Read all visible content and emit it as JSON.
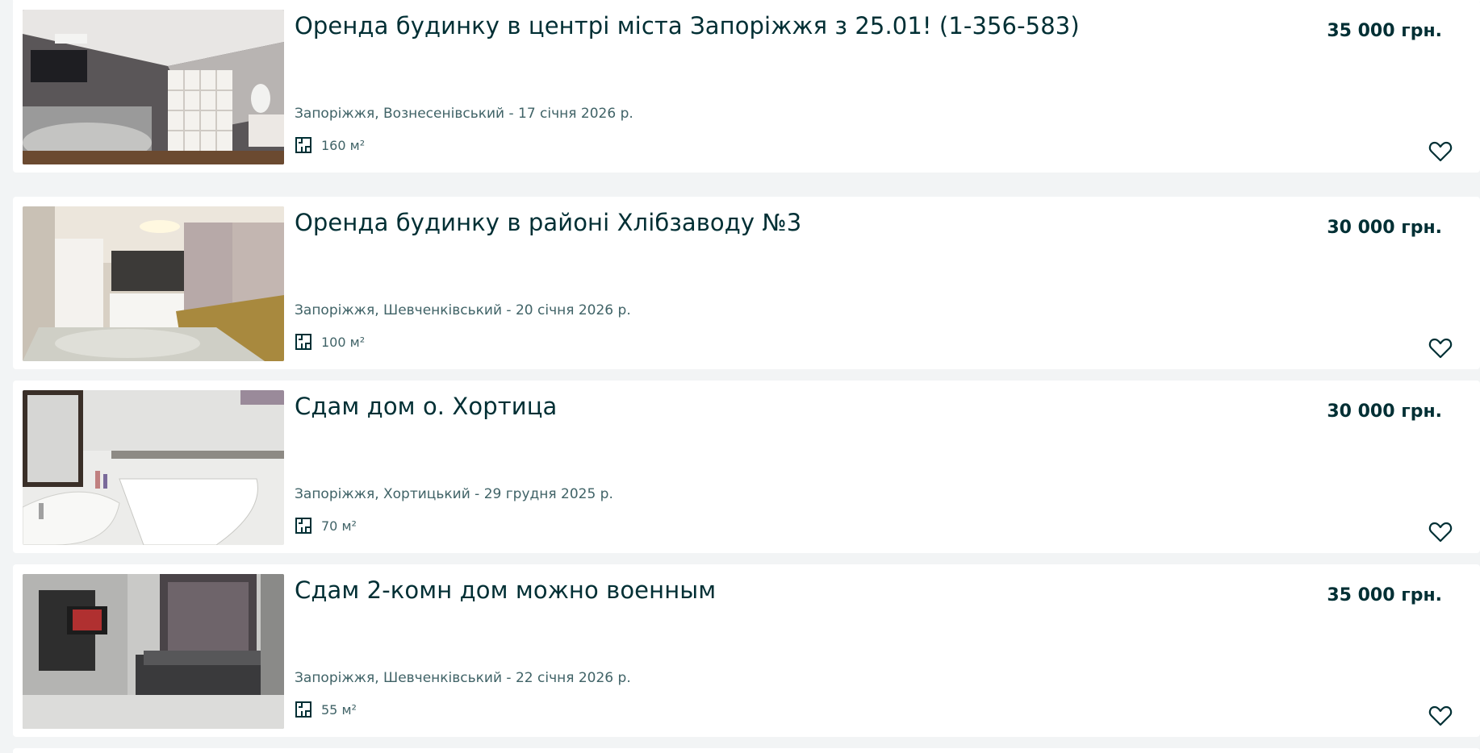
{
  "listings": [
    {
      "title": "Оренда будинку в районі Хлібзаводу №3",
      "price": "30 000 грн.",
      "location_date": "Запоріжжя, Шевченківський - 20 січня 2026 р.",
      "area": "100 м²",
      "photo": "living room with beige sofa and TV wall"
    },
    {
      "title": "Сдам дом о. Хортица",
      "price": "30 000 грн.",
      "location_date": "Запоріжжя, Хортицький - 29 грудня 2025 р.",
      "area": "70 м²",
      "photo": "bathroom with corner bathtub and sink"
    },
    {
      "title": "Сдам 2-комн дом можно военным",
      "price": "35 000 грн.",
      "location_date": "Запоріжжя, Шевченківський - 22 січня 2026 р.",
      "area": "55 м²",
      "photo": "living room with dark sofa and TV"
    },
    {
      "title": "Оренда будинку в центрі міста Запоріжжя з 25.01! (1-356-583)",
      "price": "35 000 грн.",
      "location_date": "Запоріжжя, Вознесенівський - 17 січня 2026 р.",
      "area": "160 м²",
      "photo": "attic bedroom with white shelving"
    }
  ],
  "icons": {
    "area": "floor-plan-icon",
    "favorite": "heart-outline-icon"
  },
  "colors": {
    "text": "#002f34",
    "secondary_text": "#406367",
    "background": "#f2f4f5",
    "card": "#ffffff"
  }
}
